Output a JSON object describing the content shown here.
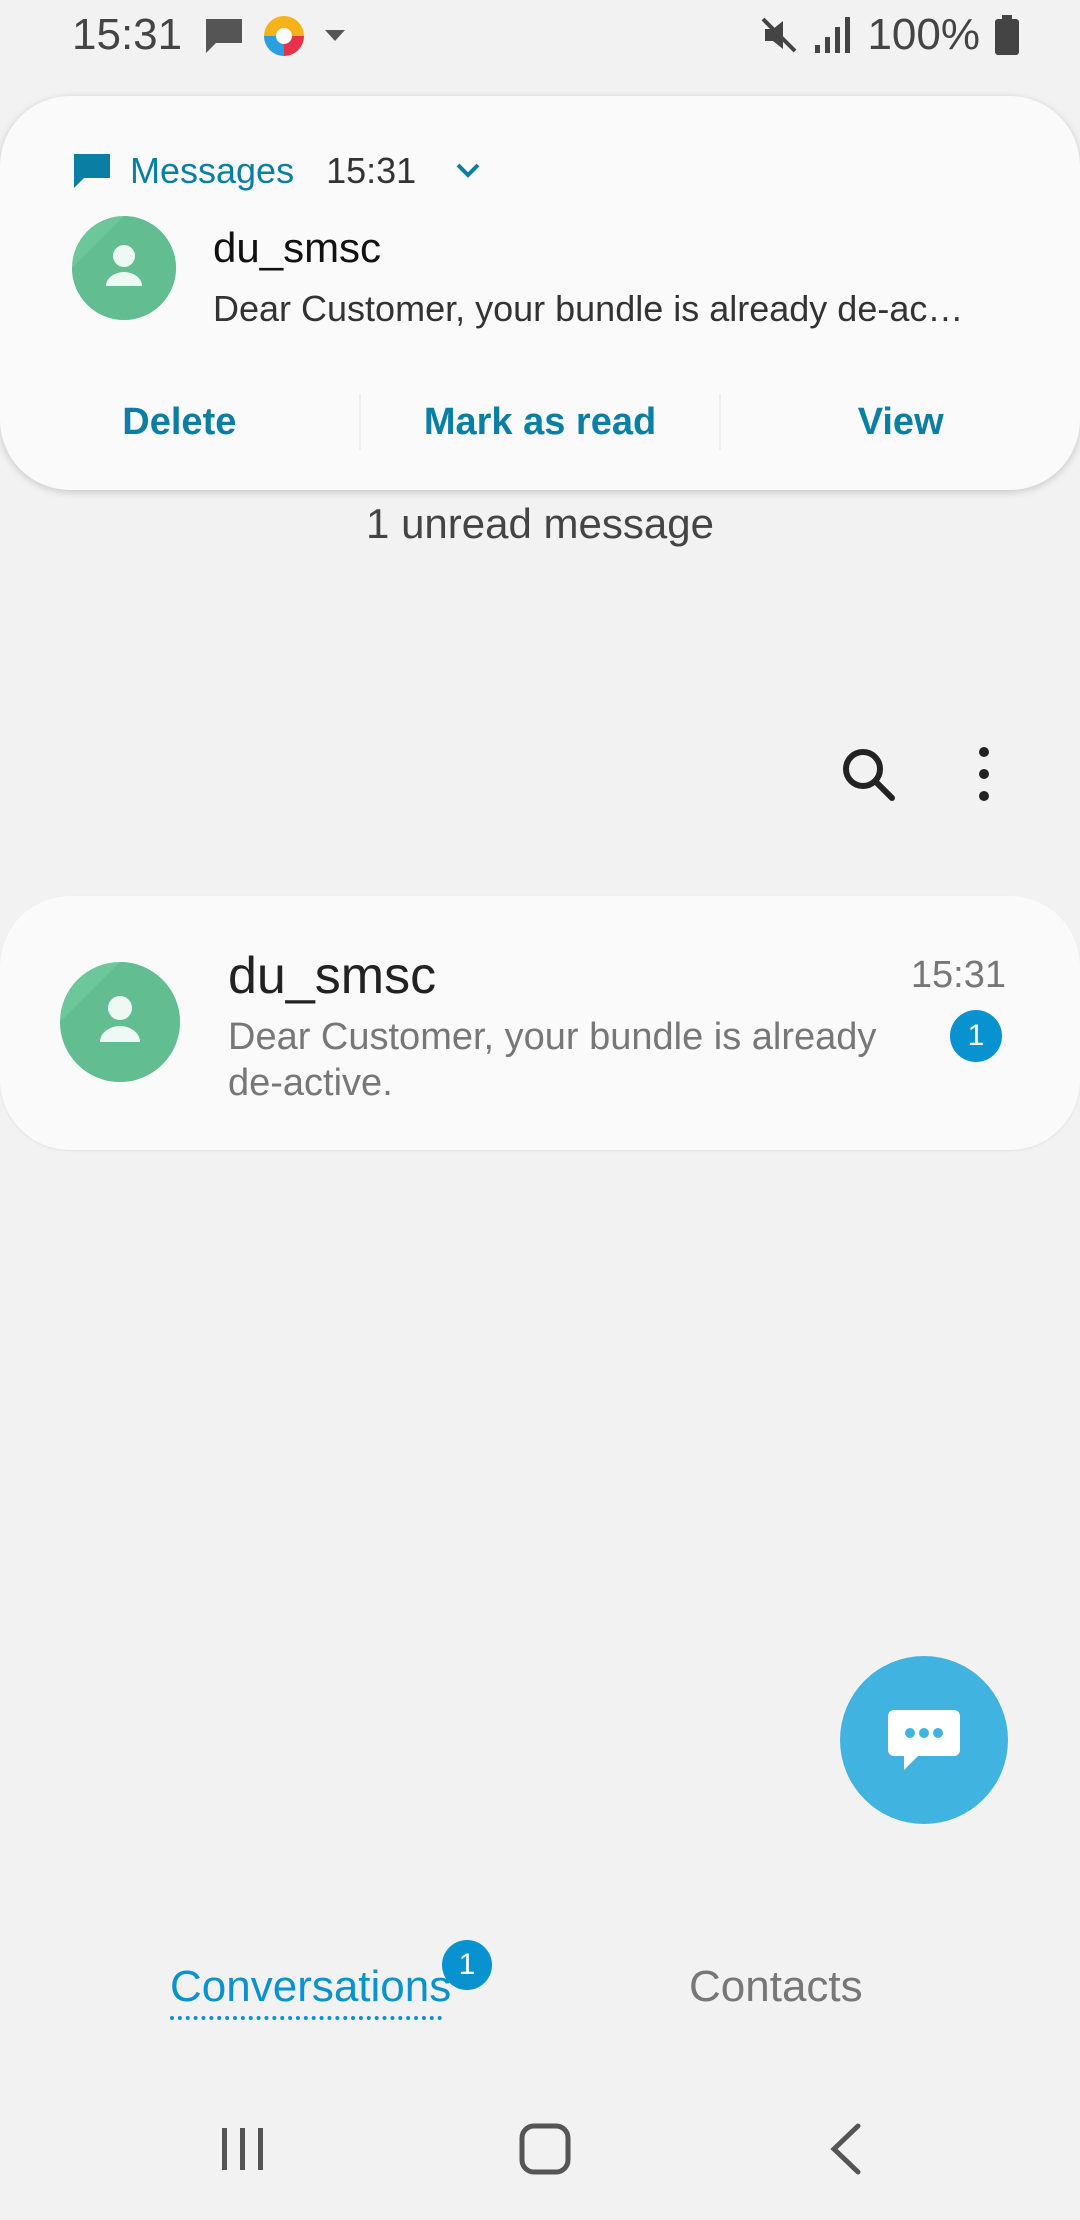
{
  "status_bar": {
    "time": "15:31",
    "battery": "100%",
    "icons": [
      "chat-bubble-icon",
      "browser-app-icon",
      "dropdown-caret-icon",
      "mute-icon",
      "signal-icon",
      "battery-icon"
    ]
  },
  "notification": {
    "app_name": "Messages",
    "time": "15:31",
    "sender": "du_smsc",
    "body": "Dear Customer, your bundle is already de-ac…",
    "actions": {
      "delete": "Delete",
      "mark_read": "Mark as read",
      "view": "View"
    }
  },
  "unread_text": "1 unread message",
  "conversation": {
    "name": "du_smsc",
    "preview": "Dear Customer, your bundle is already de-active.",
    "time": "15:31",
    "unread_count": "1"
  },
  "tabs": {
    "conversations": "Conversations",
    "conversations_badge": "1",
    "contacts": "Contacts"
  },
  "colors": {
    "accent": "#0893d0",
    "notification_accent": "#0b7fa3",
    "avatar": "#6cc89a",
    "fab": "#40b3e0"
  }
}
